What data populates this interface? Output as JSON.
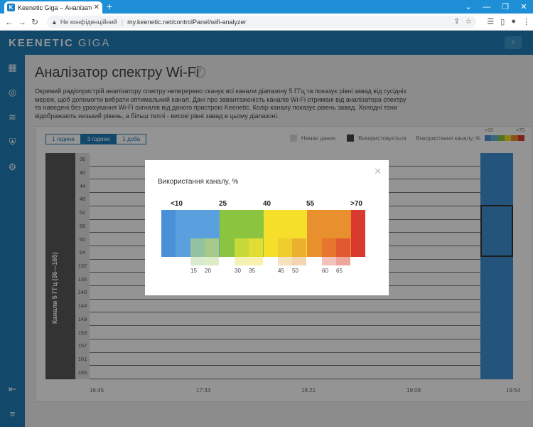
{
  "browser": {
    "tab_title": "Keenetic Giga – Аналізатор спект",
    "tab_close": "✕",
    "new_tab": "+",
    "security_label": "Не конфіденційний",
    "url": "my.keenetic.net/controlPanel/wifi-analyzer"
  },
  "header": {
    "logo_main": "KEENETIC",
    "logo_sub": "GIGA"
  },
  "page": {
    "title": "Аналізатор спектру Wi-Fi",
    "help": "?",
    "description": "Окремий радіопристрій аналізатору спектру неперервно сканує всі канали діапазону 5 ГГц та показує рівні завад від сусідніх мереж, щоб допомогти вибрати оптимальний канал. Дані про завантаженість каналів Wi-Fi отримані від аналізатора спектру та наведені без урахування Wi-Fi сигналів від даного пристрою Keenetic. Колір каналу показує рівень завад. Холодні тони відображають низький рівень, а більш теплі - високі рівні завад в цьому діапазоні."
  },
  "analyzer": {
    "ranges": [
      "1 година",
      "3 години",
      "1 доба"
    ],
    "active_range": "3 години",
    "legend_no_data": "Немає даних",
    "legend_used": "Використовується",
    "legend_usage": "Використання каналу, %",
    "scale_min": "<10",
    "scale_max": ">70",
    "channel_axis_title": "Канали 5 ГГц (36—165)",
    "channels": [
      "36",
      "40",
      "44",
      "48",
      "52",
      "56",
      "60",
      "64",
      "132",
      "136",
      "140",
      "144",
      "149",
      "153",
      "157",
      "161",
      "165"
    ],
    "times": [
      "16:45",
      "17:33",
      "18:21",
      "19:09",
      "19:54"
    ]
  },
  "modal": {
    "title": "Використання каналу, %",
    "close": "✕",
    "top_labels": [
      "<10",
      "25",
      "40",
      "55",
      ">70"
    ],
    "bottom_labels": [
      "15",
      "20",
      "30",
      "35",
      "45",
      "50",
      "60",
      "65"
    ],
    "colors": {
      "blue": "#4a90d9",
      "green": "#8bc540",
      "yellow": "#f5df2b",
      "orange": "#e8902d",
      "red": "#d9392e"
    }
  }
}
